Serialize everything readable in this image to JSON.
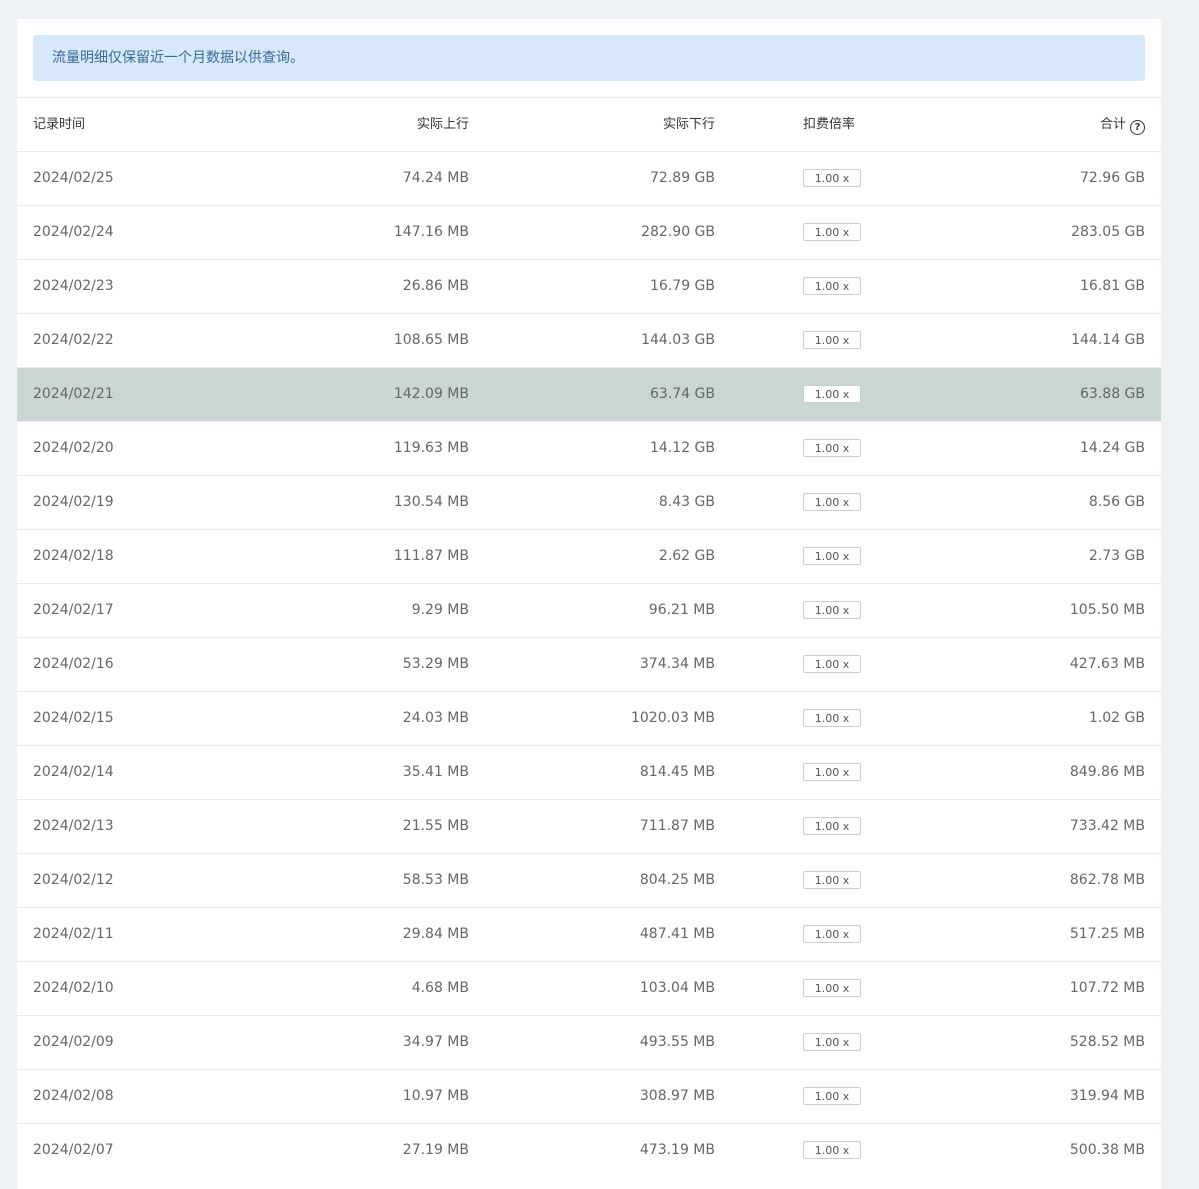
{
  "notice": "流量明细仅保留近一个月数据以供查询。",
  "columns": {
    "date": "记录时间",
    "upload": "实际上行",
    "download": "实际下行",
    "rate": "扣费倍率",
    "total": "合计"
  },
  "rows": [
    {
      "date": "2024/02/25",
      "upload": "74.24 MB",
      "download": "72.89 GB",
      "rate": "1.00 x",
      "total": "72.96 GB"
    },
    {
      "date": "2024/02/24",
      "upload": "147.16 MB",
      "download": "282.90 GB",
      "rate": "1.00 x",
      "total": "283.05 GB"
    },
    {
      "date": "2024/02/23",
      "upload": "26.86 MB",
      "download": "16.79 GB",
      "rate": "1.00 x",
      "total": "16.81 GB"
    },
    {
      "date": "2024/02/22",
      "upload": "108.65 MB",
      "download": "144.03 GB",
      "rate": "1.00 x",
      "total": "144.14 GB"
    },
    {
      "date": "2024/02/21",
      "upload": "142.09 MB",
      "download": "63.74 GB",
      "rate": "1.00 x",
      "total": "63.88 GB"
    },
    {
      "date": "2024/02/20",
      "upload": "119.63 MB",
      "download": "14.12 GB",
      "rate": "1.00 x",
      "total": "14.24 GB"
    },
    {
      "date": "2024/02/19",
      "upload": "130.54 MB",
      "download": "8.43 GB",
      "rate": "1.00 x",
      "total": "8.56 GB"
    },
    {
      "date": "2024/02/18",
      "upload": "111.87 MB",
      "download": "2.62 GB",
      "rate": "1.00 x",
      "total": "2.73 GB"
    },
    {
      "date": "2024/02/17",
      "upload": "9.29 MB",
      "download": "96.21 MB",
      "rate": "1.00 x",
      "total": "105.50 MB"
    },
    {
      "date": "2024/02/16",
      "upload": "53.29 MB",
      "download": "374.34 MB",
      "rate": "1.00 x",
      "total": "427.63 MB"
    },
    {
      "date": "2024/02/15",
      "upload": "24.03 MB",
      "download": "1020.03 MB",
      "rate": "1.00 x",
      "total": "1.02 GB"
    },
    {
      "date": "2024/02/14",
      "upload": "35.41 MB",
      "download": "814.45 MB",
      "rate": "1.00 x",
      "total": "849.86 MB"
    },
    {
      "date": "2024/02/13",
      "upload": "21.55 MB",
      "download": "711.87 MB",
      "rate": "1.00 x",
      "total": "733.42 MB"
    },
    {
      "date": "2024/02/12",
      "upload": "58.53 MB",
      "download": "804.25 MB",
      "rate": "1.00 x",
      "total": "862.78 MB"
    },
    {
      "date": "2024/02/11",
      "upload": "29.84 MB",
      "download": "487.41 MB",
      "rate": "1.00 x",
      "total": "517.25 MB"
    },
    {
      "date": "2024/02/10",
      "upload": "4.68 MB",
      "download": "103.04 MB",
      "rate": "1.00 x",
      "total": "107.72 MB"
    },
    {
      "date": "2024/02/09",
      "upload": "34.97 MB",
      "download": "493.55 MB",
      "rate": "1.00 x",
      "total": "528.52 MB"
    },
    {
      "date": "2024/02/08",
      "upload": "10.97 MB",
      "download": "308.97 MB",
      "rate": "1.00 x",
      "total": "319.94 MB"
    },
    {
      "date": "2024/02/07",
      "upload": "27.19 MB",
      "download": "473.19 MB",
      "rate": "1.00 x",
      "total": "500.38 MB"
    }
  ],
  "colors": {
    "notice_bg": "#d6e8f9",
    "notice_text": "#3c6a97",
    "hover_row": "#c9d6d4",
    "page_bg": "#eef2f7"
  },
  "icons": {
    "total_help": "question-circle-icon"
  }
}
